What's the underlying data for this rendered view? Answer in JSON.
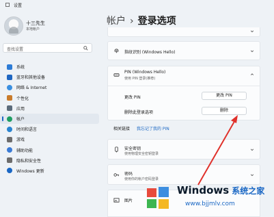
{
  "window": {
    "title": "设置"
  },
  "profile": {
    "name": "十三先生",
    "sub": "本地帐户"
  },
  "search": {
    "placeholder": "查找设置"
  },
  "nav": {
    "items": [
      {
        "label": "系统",
        "color": "#2d7cd6"
      },
      {
        "label": "蓝牙和其他设备",
        "color": "#1f66c1"
      },
      {
        "label": "网络 & Internet",
        "color": "#3b8fe0"
      },
      {
        "label": "个性化",
        "color": "#c97b2b"
      },
      {
        "label": "应用",
        "color": "#5b6b7a"
      },
      {
        "label": "帐户",
        "color": "#1e9e62"
      },
      {
        "label": "时间和语言",
        "color": "#2a84d0"
      },
      {
        "label": "游戏",
        "color": "#6c6c6c"
      },
      {
        "label": "辅助功能",
        "color": "#3a7bd5"
      },
      {
        "label": "隐私和安全性",
        "color": "#6c6c6c"
      },
      {
        "label": "Windows 更新",
        "color": "#1a67c4"
      }
    ],
    "active_index": 5
  },
  "breadcrumb": {
    "parent": "帐户",
    "separator": "›",
    "current": "登录选项"
  },
  "main": {
    "fingerprint": {
      "title": "指纹识别 (Windows Hello)"
    },
    "pin": {
      "title": "PIN (Windows Hello)",
      "sub": "使用 PIN 登录(推荐)",
      "change_label": "更改 PIN",
      "change_button": "更改 PIN",
      "remove_label": "删除此登录选项",
      "remove_button": "删除"
    },
    "related": {
      "label": "相关链接",
      "link": "我忘记了我的 PIN"
    },
    "security_key": {
      "title": "安全密钥",
      "sub": "使用物理安全密钥登录"
    },
    "password": {
      "title": "密码",
      "sub": "使用你的帐户密码登录"
    },
    "picture": {
      "title": "图片"
    }
  },
  "watermark": {
    "brand": "Windows",
    "brand_cn": "系统之家",
    "url": "www.bjjmlv.com"
  }
}
